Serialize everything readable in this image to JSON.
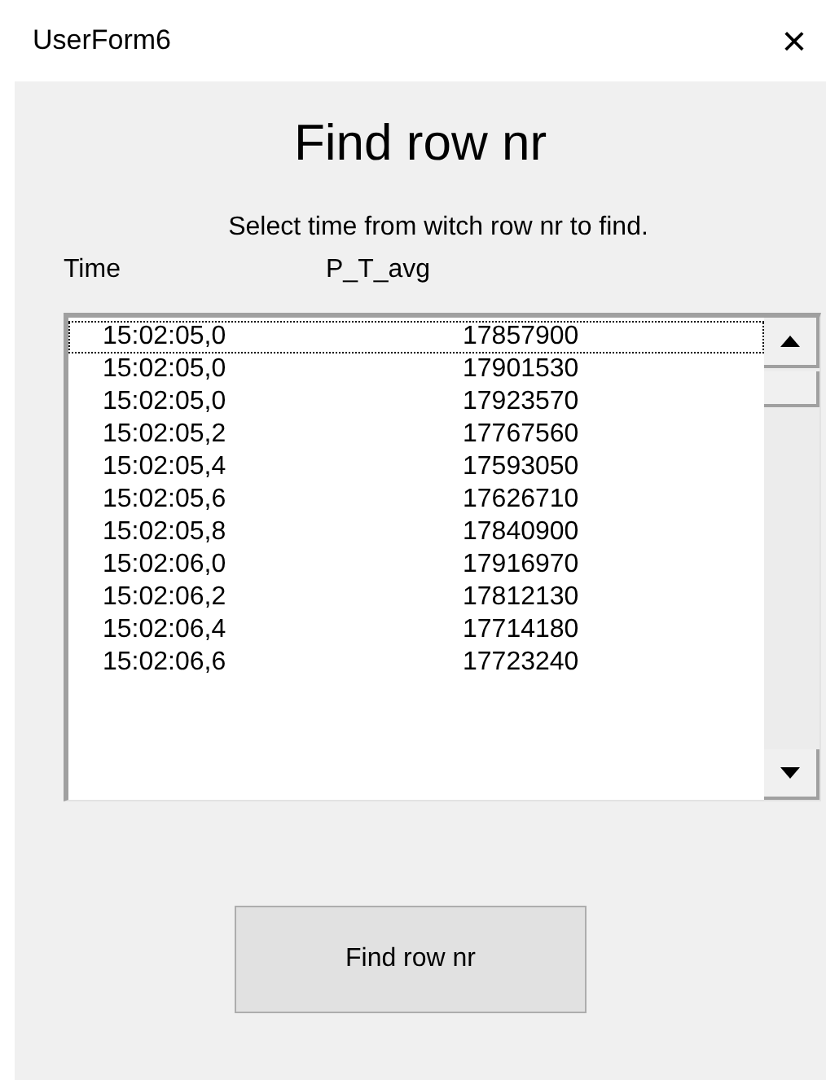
{
  "window": {
    "title": "UserForm6",
    "close": "×"
  },
  "heading": "Find row nr",
  "instruction": "Select time from witch row nr to find.",
  "columns": [
    "Time",
    "P_T_avg"
  ],
  "rows": [
    {
      "time": "15:02:05,0",
      "value": "17857900",
      "focused": true
    },
    {
      "time": "15:02:05,0",
      "value": "17901530",
      "focused": false
    },
    {
      "time": "15:02:05,0",
      "value": "17923570",
      "focused": false
    },
    {
      "time": "15:02:05,2",
      "value": "17767560",
      "focused": false
    },
    {
      "time": "15:02:05,4",
      "value": "17593050",
      "focused": false
    },
    {
      "time": "15:02:05,6",
      "value": "17626710",
      "focused": false
    },
    {
      "time": "15:02:05,8",
      "value": "17840900",
      "focused": false
    },
    {
      "time": "15:02:06,0",
      "value": "17916970",
      "focused": false
    },
    {
      "time": "15:02:06,2",
      "value": "17812130",
      "focused": false
    },
    {
      "time": "15:02:06,4",
      "value": "17714180",
      "focused": false
    },
    {
      "time": "15:02:06,6",
      "value": "17723240",
      "focused": false
    }
  ],
  "button": "Find row nr"
}
